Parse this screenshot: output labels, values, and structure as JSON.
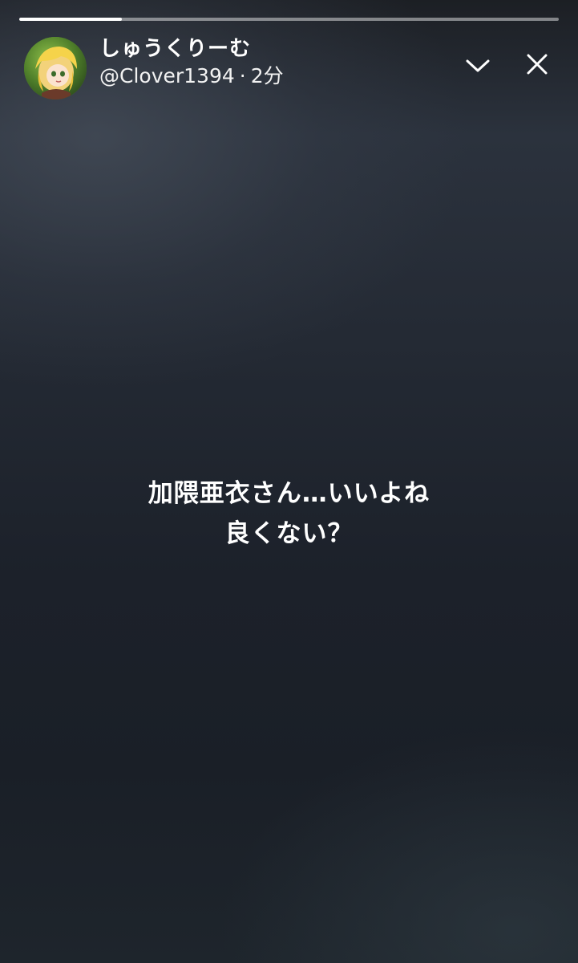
{
  "story": {
    "progress": 0.19,
    "user": {
      "display_name": "しゅうくりーむ",
      "handle": "@Clover1394",
      "separator": "·",
      "time_ago": "2分",
      "avatar_icon": "user-avatar-icon"
    },
    "controls": {
      "collapse_icon": "chevron-down-icon",
      "close_icon": "close-icon"
    },
    "text_lines": [
      "加隈亜衣さん…いいよね",
      "良くない？"
    ]
  },
  "colors": {
    "background": "#1b2028",
    "progress_track": "#8d9096",
    "progress_fill": "#ffffff",
    "text": "#ffffff"
  }
}
